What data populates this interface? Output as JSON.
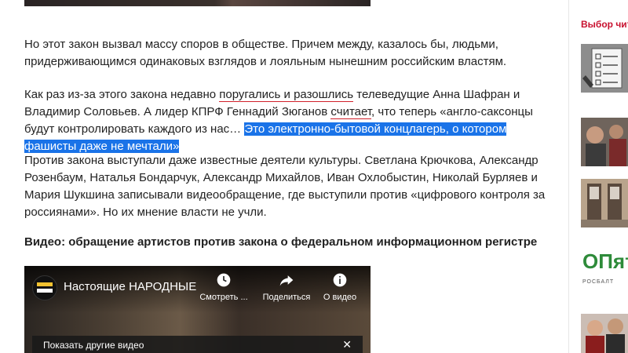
{
  "article": {
    "p1": "Но этот закон вызвал массу споров в обществе. Причем между, казалось бы, людьми, придерживающимся одинаковых взглядов и лояльным нынешним российским властям.",
    "p2": {
      "before": "Как раз из-за этого закона недавно ",
      "link1": "поругались и разошлись",
      "middle": " телеведущие Анна Шафран и Владимир Соловьев. А лидер КПРФ Геннадий Зюганов ",
      "link2": "считает",
      "after": ", что теперь «англо-саксонцы будут контролировать каждого из нас… ",
      "highlight": "Это электронно-бытовой концлагерь, о котором фашисты даже не мечтали»"
    },
    "p3": "Против закона выступали даже известные деятели культуры. Светлана Крючкова, Александр Розенбаум, Наталья Бондарчук, Александр Михайлов, Иван Охлобыстин, Николай Бурляев и Мария Шукшина записывали видеообращение, где выступили против «цифрового контроля за россиянами». Но их мнение власти не учли.",
    "video_heading": "Видео: обращение артистов против закона о федеральном информационном регистре"
  },
  "video": {
    "title": "Настоящие НАРОДНЫЕ...",
    "watch_later": "Смотреть ...",
    "share": "Поделиться",
    "info": "О видео",
    "more_videos": "Показать другие видео",
    "close": "✕"
  },
  "sidebar": {
    "title": "Выбор чита",
    "brand_big": "ОПят",
    "brand_small": "РОСБАЛТ"
  },
  "colors": {
    "accent": "#c8102e",
    "selection": "#1a73e8"
  }
}
